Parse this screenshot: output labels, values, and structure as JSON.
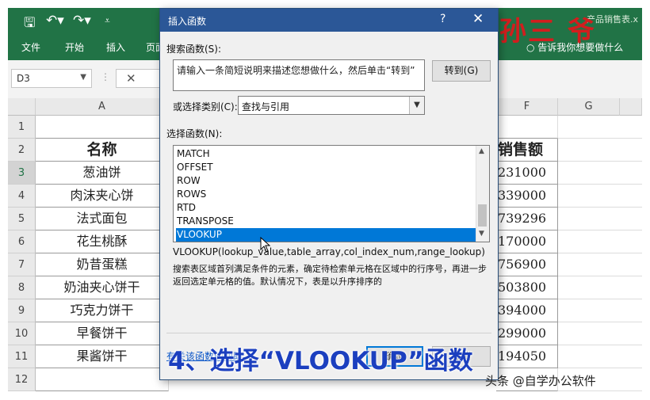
{
  "app": {
    "file_title": "产品销售表.x",
    "logo_text": "孙三 爷",
    "tabs": [
      "文件",
      "开始",
      "插入",
      "页面"
    ],
    "tell_me": "告诉我你想要做什么"
  },
  "formula_bar": {
    "name_box": "D3",
    "fx": "⋮",
    "cancel": "✕"
  },
  "grid": {
    "columns": [
      "A",
      "F",
      "G"
    ],
    "rows": [
      "1",
      "2",
      "3",
      "4",
      "5",
      "6",
      "7",
      "8",
      "9",
      "10",
      "11",
      "12"
    ],
    "colA": [
      "",
      "名称",
      "葱油饼",
      "肉沫夹心饼",
      "法式面包",
      "花生桃酥",
      "奶昔蛋糕",
      "奶油夹心饼干",
      "巧克力饼干",
      "早餐饼干",
      "果酱饼干",
      ""
    ],
    "colF": [
      "",
      "销售额",
      "231000",
      "339000",
      "739296",
      "170000",
      "756900",
      "503800",
      "394000",
      "299000",
      "194050",
      ""
    ]
  },
  "dialog": {
    "title": "插入函数",
    "help": "?",
    "close": "✕",
    "search_label": "搜索函数(S):",
    "search_value": "请输入一条简短说明来描述您想做什么，然后单击“转到”",
    "goto_button": "转到(G)",
    "category_label": "或选择类别(C):",
    "category_value": "查找与引用",
    "select_label": "选择函数(N):",
    "functions": [
      "MATCH",
      "OFFSET",
      "ROW",
      "ROWS",
      "RTD",
      "TRANSPOSE",
      "VLOOKUP"
    ],
    "selected_index": 6,
    "signature": "VLOOKUP(lookup_value,table_array,col_index_num,range_lookup)",
    "description": "搜索表区域首列满足条件的元素，确定待检索单元格在区域中的行序号，再进一步返回选定单元格的值。默认情况下，表是以升序排序的",
    "help_link": "有关该函数的帮助",
    "ok_button": "确定",
    "cancel_button": "取消"
  },
  "overlay": {
    "caption": "4、选择“VLOOKUP”函数",
    "watermark": "头条 @自学办公软件"
  },
  "colors": {
    "excel_green": "#217346",
    "dialog_title": "#2b5797",
    "selection": "#0078d7",
    "caption": "#1b3fbf"
  }
}
